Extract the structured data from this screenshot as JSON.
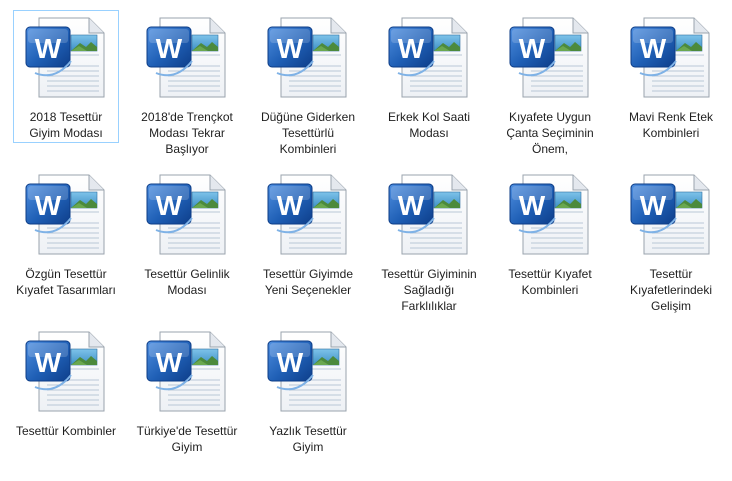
{
  "files": [
    {
      "label": "2018 Tesettür Giyim Modası",
      "icon": "word-document-icon",
      "selected": true
    },
    {
      "label": "2018'de Trençkot Modası Tekrar Başlıyor",
      "icon": "word-document-icon"
    },
    {
      "label": "Düğüne Giderken Tesettürlü Kombinleri",
      "icon": "word-document-icon"
    },
    {
      "label": "Erkek Kol Saati Modası",
      "icon": "word-document-icon"
    },
    {
      "label": "Kıyafete Uygun Çanta Seçiminin Önem,",
      "icon": "word-document-icon"
    },
    {
      "label": "Mavi Renk Etek Kombinleri",
      "icon": "word-document-icon"
    },
    {
      "label": "Özgün Tesettür Kıyafet Tasarımları",
      "icon": "word-document-icon"
    },
    {
      "label": "Tesettür Gelinlik Modası",
      "icon": "word-document-icon"
    },
    {
      "label": "Tesettür Giyimde Yeni Seçenekler",
      "icon": "word-document-icon"
    },
    {
      "label": "Tesettür Giyiminin Sağladığı Farklılıklar",
      "icon": "word-document-icon"
    },
    {
      "label": "Tesettür Kıyafet Kombinleri",
      "icon": "word-document-icon"
    },
    {
      "label": "Tesettür Kıyafetlerindeki Gelişim",
      "icon": "word-document-icon"
    },
    {
      "label": "Tesettür Kombinler",
      "icon": "word-document-icon"
    },
    {
      "label": "Türkiye'de Tesettür Giyim",
      "icon": "word-document-icon"
    },
    {
      "label": "Yazlık Tesettür Giyim",
      "icon": "word-document-icon"
    }
  ],
  "colors": {
    "selection_border": "#99d1ff",
    "word_blue": "#1f5fb5",
    "text": "#1e1e1e"
  }
}
